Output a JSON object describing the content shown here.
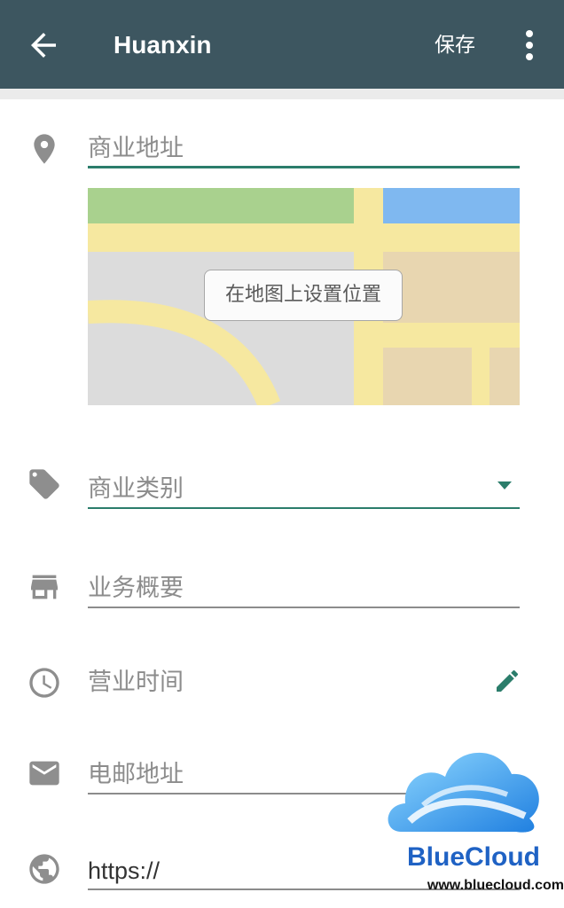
{
  "appbar": {
    "title": "Huanxin",
    "save_label": "保存",
    "back_icon": "arrow-back-icon",
    "more_icon": "more-vert-icon",
    "color": "#3d5660"
  },
  "form": {
    "address": {
      "placeholder": "商业地址",
      "icon": "location-pin-icon"
    },
    "map": {
      "set_location_label": "在地图上设置位置"
    },
    "category": {
      "placeholder": "商业类别",
      "icon": "tag-icon"
    },
    "description": {
      "placeholder": "业务概要",
      "icon": "store-icon"
    },
    "hours": {
      "placeholder": "营业时间",
      "icon": "clock-icon"
    },
    "email": {
      "placeholder": "电邮地址",
      "icon": "mail-icon"
    },
    "website": {
      "value": "https://",
      "icon": "globe-icon"
    }
  },
  "accent_color": "#2b7d6b",
  "watermark": {
    "brand": "BlueCloud",
    "url": "www.bluecloud.com"
  }
}
